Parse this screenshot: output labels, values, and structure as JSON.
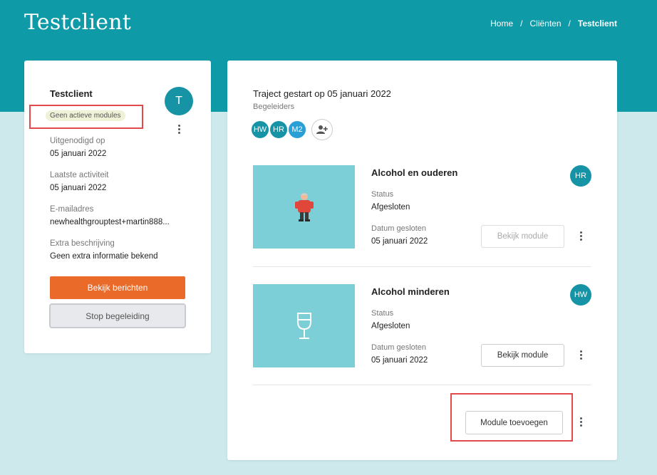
{
  "header": {
    "title": "Testclient",
    "breadcrumb": [
      "Home",
      "/",
      "Cliënten",
      "/",
      "Testclient"
    ]
  },
  "client_card": {
    "name": "Testclient",
    "avatar_letter": "T",
    "badge": "Geen actieve modules",
    "fields": [
      {
        "label": "Uitgenodigd op",
        "value": "05 januari 2022"
      },
      {
        "label": "Laatste activiteit",
        "value": "05 januari 2022"
      },
      {
        "label": "E-mailadres",
        "value": "newhealthgrouptest+martin888..."
      },
      {
        "label": "Extra beschrijving",
        "value": "Geen extra informatie bekend"
      }
    ],
    "primary_button": "Bekijk berichten",
    "secondary_button": "Stop begeleiding"
  },
  "trajectory": {
    "title": "Traject gestart op 05 januari 2022",
    "coaches_label": "Begeleiders",
    "coaches": [
      {
        "initials": "HW",
        "color": "#1694a6"
      },
      {
        "initials": "HR",
        "color": "#1694a6"
      },
      {
        "initials": "M2",
        "color": "#2a9fd6"
      }
    ],
    "modules": [
      {
        "title": "Alcohol en ouderen",
        "status_label": "Status",
        "status": "Afgesloten",
        "date_label": "Datum gesloten",
        "date": "05 januari 2022",
        "coach": "HR",
        "button": "Bekijk module",
        "icon": "elderly-person-illustration"
      },
      {
        "title": "Alcohol minderen",
        "status_label": "Status",
        "status": "Afgesloten",
        "date_label": "Datum gesloten",
        "date": "05 januari 2022",
        "coach": "HW",
        "button": "Bekijk module",
        "icon": "wine-glass-icon"
      }
    ],
    "add_button": "Module toevoegen"
  },
  "colors": {
    "hero": "#0f9aa7",
    "background": "#cde9ec",
    "primary": "#ea6a2a",
    "highlight": "#e2494b",
    "tile": "#7ccfd6"
  }
}
